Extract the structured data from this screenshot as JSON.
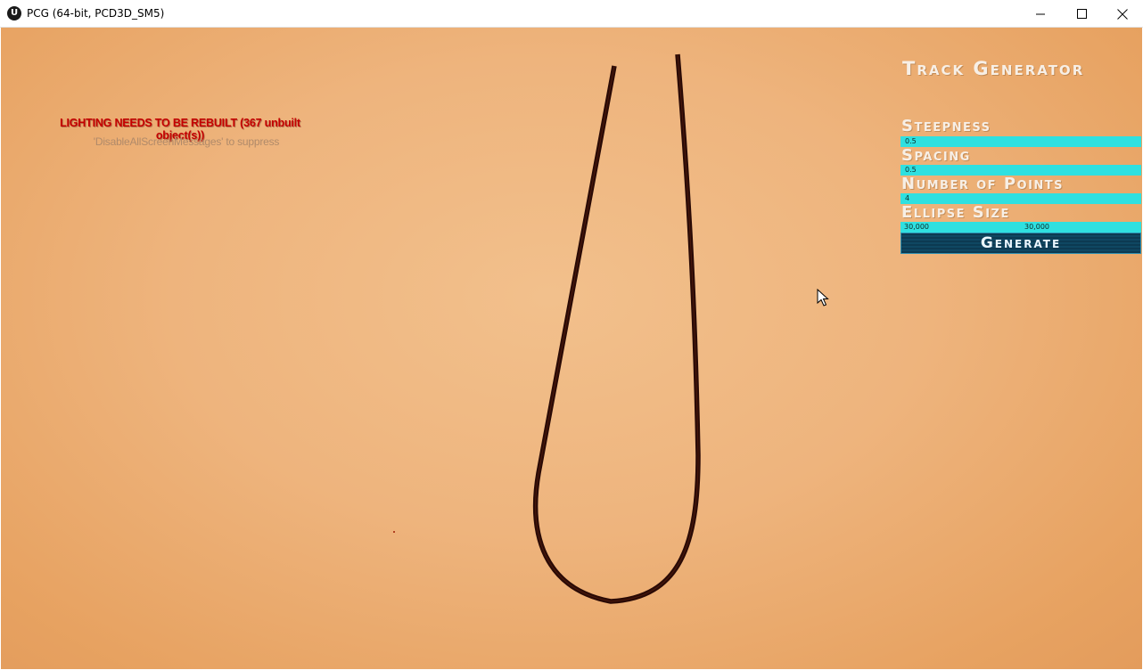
{
  "window": {
    "title": "PCG (64-bit, PCD3D_SM5)",
    "icon": "unreal-logo-icon",
    "controls": [
      "minimize-icon",
      "maximize-icon",
      "close-icon"
    ]
  },
  "messages": {
    "warning": "LIGHTING NEEDS TO BE REBUILT (367 unbuilt object(s))",
    "hint": "'DisableAllScreenMessages' to suppress",
    "warning_color": "#c40000"
  },
  "panel": {
    "title": "Track Generator",
    "params": [
      {
        "label": "Steepness",
        "value": "0.5"
      },
      {
        "label": "Spacing",
        "value": "0.5"
      },
      {
        "label": "Number of Points",
        "value": "4"
      },
      {
        "label": "Ellipse Size",
        "value": "30,000",
        "value2": "30,000"
      }
    ],
    "generate_label": "Generate",
    "accent_color": "#2fe0e0",
    "button_color": "#0c3a52"
  },
  "scene": {
    "background_color": "#f0bb86",
    "track_color": "#2a0a05"
  }
}
